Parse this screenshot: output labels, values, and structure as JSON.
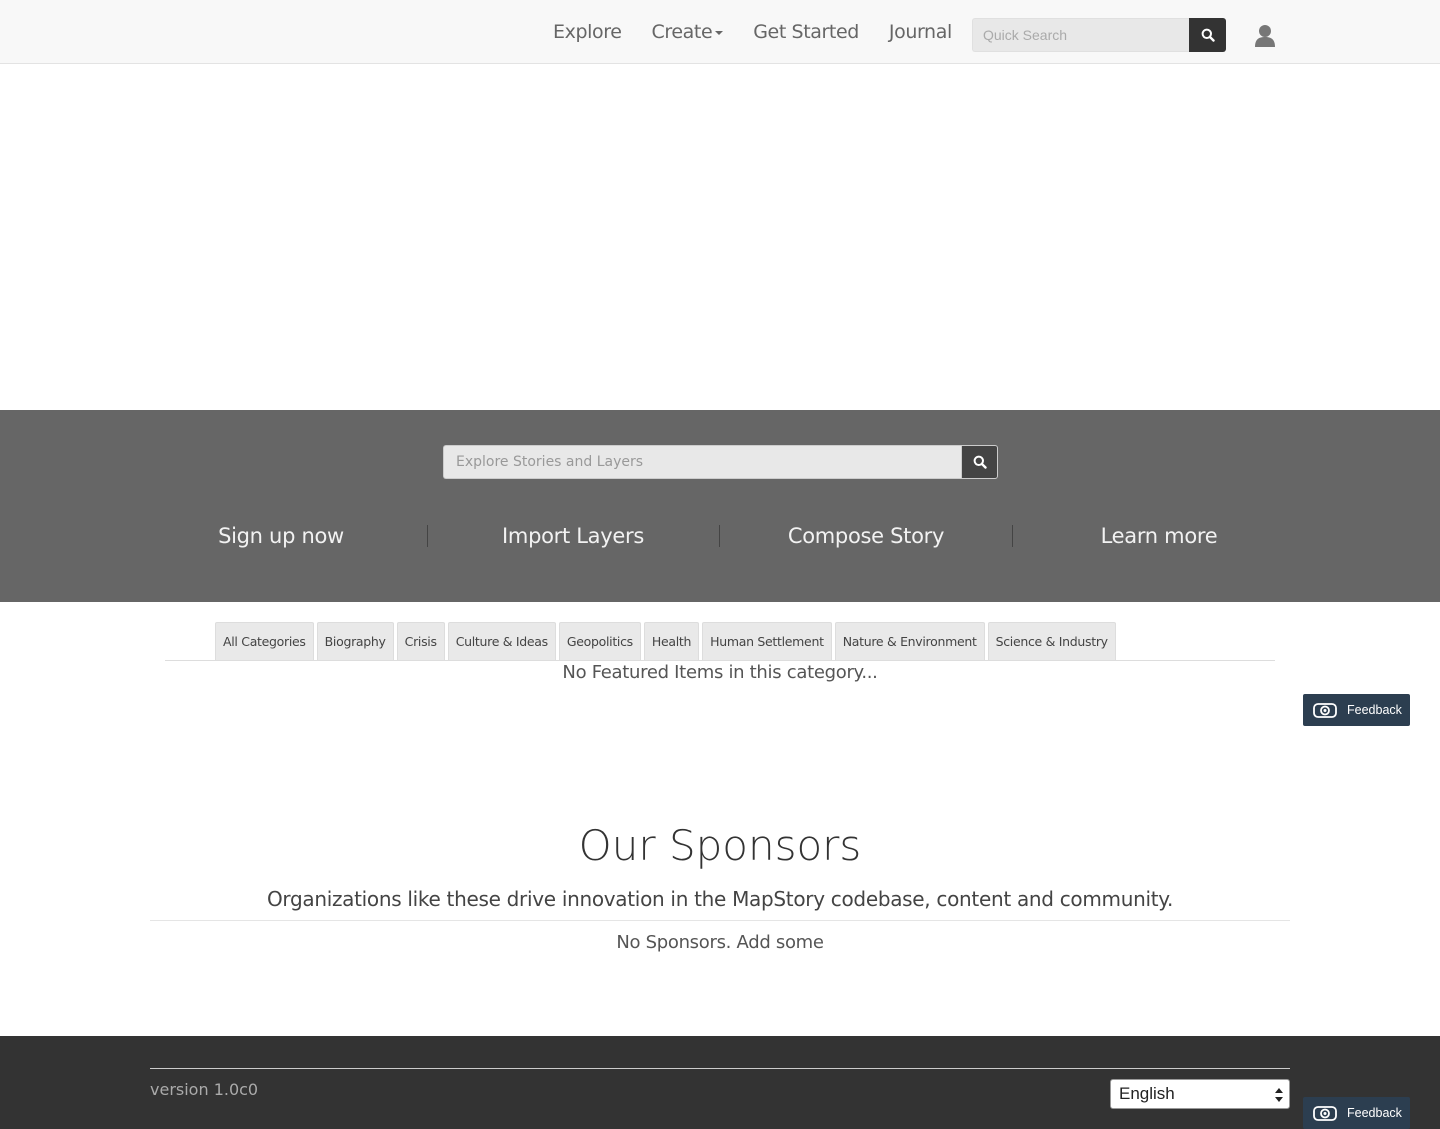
{
  "navbar": {
    "links": [
      "Explore",
      "Create",
      "Get Started",
      "Journal"
    ],
    "quick_search_placeholder": "Quick Search",
    "icons": {
      "search": "search-icon",
      "user": "user-icon"
    }
  },
  "band": {
    "explore_placeholder": "Explore Stories and Layers",
    "ctas": [
      "Sign up now",
      "Import Layers",
      "Compose Story",
      "Learn more"
    ]
  },
  "categories": {
    "tabs": [
      "All Categories",
      "Biography",
      "Crisis",
      "Culture & Ideas",
      "Geopolitics",
      "Health",
      "Human Settlement",
      "Nature & Environment",
      "Science & Industry"
    ],
    "empty_message": "No Featured Items in this category..."
  },
  "feedback": {
    "label": "Feedback",
    "icon": "camera-icon"
  },
  "sponsors": {
    "title": "Our Sponsors",
    "subtitle": "Organizations like these drive innovation in the MapStory codebase, content and community.",
    "empty_message": "No Sponsors. Add some"
  },
  "footer": {
    "version": "version 1.0c0",
    "language": "English"
  },
  "colors": {
    "navbar_bg": "#f8f8f8",
    "band_bg": "#666666",
    "footer_bg": "#333333",
    "feedback_bg": "#2c3e50"
  }
}
